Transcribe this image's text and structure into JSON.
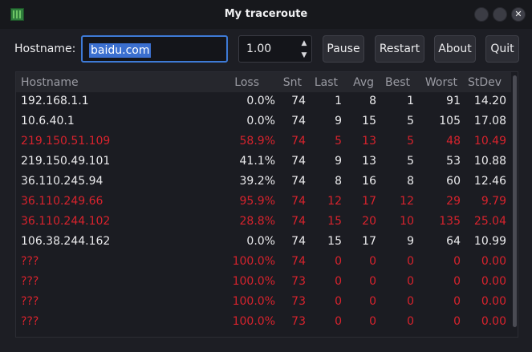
{
  "window": {
    "title": "My traceroute"
  },
  "toolbar": {
    "hostname_label": "Hostname:",
    "hostname_value": "baidu.com",
    "interval_value": "1.00",
    "pause_label": "Pause",
    "restart_label": "Restart",
    "about_label": "About",
    "quit_label": "Quit"
  },
  "table": {
    "columns": [
      "Hostname",
      "Loss",
      "Snt",
      "Last",
      "Avg",
      "Best",
      "Worst",
      "StDev"
    ],
    "rows": [
      {
        "host": "192.168.1.1",
        "loss": "0.0%",
        "snt": "74",
        "last": "1",
        "avg": "8",
        "best": "1",
        "worst": "91",
        "stdev": "14.20",
        "status": "ok"
      },
      {
        "host": "10.6.40.1",
        "loss": "0.0%",
        "snt": "74",
        "last": "9",
        "avg": "15",
        "best": "5",
        "worst": "105",
        "stdev": "17.08",
        "status": "ok"
      },
      {
        "host": "219.150.51.109",
        "loss": "58.9%",
        "snt": "74",
        "last": "5",
        "avg": "13",
        "best": "5",
        "worst": "48",
        "stdev": "10.49",
        "status": "bad"
      },
      {
        "host": "219.150.49.101",
        "loss": "41.1%",
        "snt": "74",
        "last": "9",
        "avg": "13",
        "best": "5",
        "worst": "53",
        "stdev": "10.88",
        "status": "ok"
      },
      {
        "host": "36.110.245.94",
        "loss": "39.2%",
        "snt": "74",
        "last": "8",
        "avg": "16",
        "best": "8",
        "worst": "60",
        "stdev": "12.46",
        "status": "ok"
      },
      {
        "host": "36.110.249.66",
        "loss": "95.9%",
        "snt": "74",
        "last": "12",
        "avg": "17",
        "best": "12",
        "worst": "29",
        "stdev": "9.79",
        "status": "bad"
      },
      {
        "host": "36.110.244.102",
        "loss": "28.8%",
        "snt": "74",
        "last": "15",
        "avg": "20",
        "best": "10",
        "worst": "135",
        "stdev": "25.04",
        "status": "bad"
      },
      {
        "host": "106.38.244.162",
        "loss": "0.0%",
        "snt": "74",
        "last": "15",
        "avg": "17",
        "best": "9",
        "worst": "64",
        "stdev": "10.99",
        "status": "ok"
      },
      {
        "host": "???",
        "loss": "100.0%",
        "snt": "74",
        "last": "0",
        "avg": "0",
        "best": "0",
        "worst": "0",
        "stdev": "0.00",
        "status": "bad"
      },
      {
        "host": "???",
        "loss": "100.0%",
        "snt": "73",
        "last": "0",
        "avg": "0",
        "best": "0",
        "worst": "0",
        "stdev": "0.00",
        "status": "bad"
      },
      {
        "host": "???",
        "loss": "100.0%",
        "snt": "73",
        "last": "0",
        "avg": "0",
        "best": "0",
        "worst": "0",
        "stdev": "0.00",
        "status": "bad"
      },
      {
        "host": "???",
        "loss": "100.0%",
        "snt": "73",
        "last": "0",
        "avg": "0",
        "best": "0",
        "worst": "0",
        "stdev": "0.00",
        "status": "bad"
      }
    ]
  },
  "icons": {
    "app": "traceroute-app-icon",
    "minimize": "minimize-icon",
    "maximize": "maximize-icon",
    "close": "close-icon",
    "spin_up": "chevron-up-icon",
    "spin_down": "chevron-down-icon"
  },
  "colors": {
    "ok_text": "#ececee",
    "error_text": "#d8232d",
    "accent": "#3e7ad6"
  }
}
